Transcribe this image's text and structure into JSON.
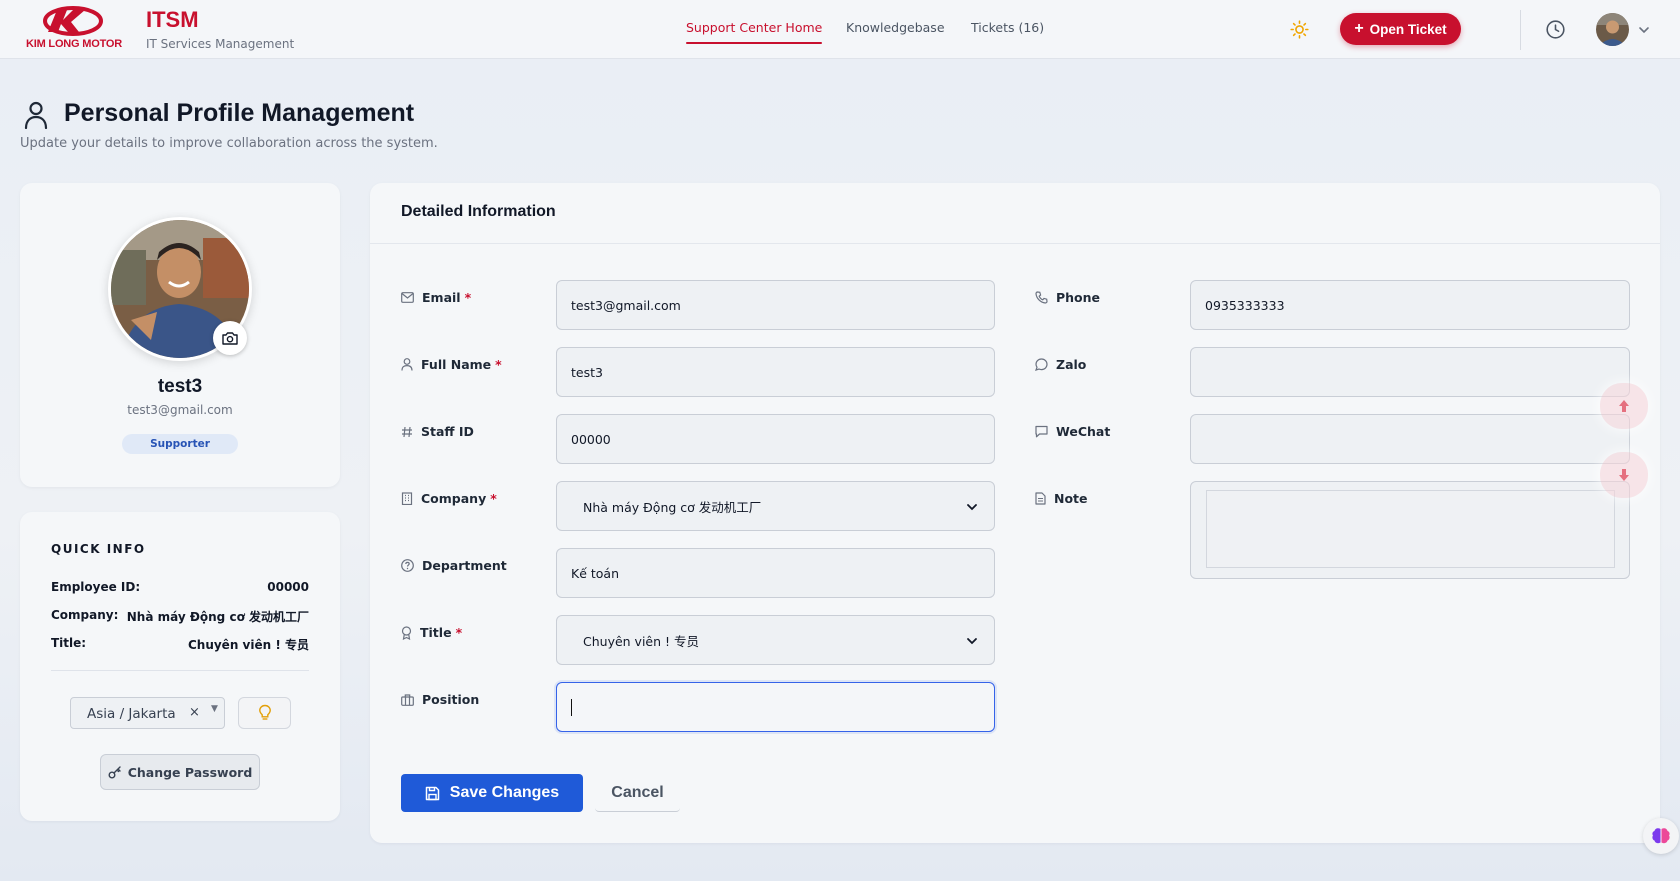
{
  "header": {
    "brand_name": "KIM LONG MOTOR",
    "app_title": "ITSM",
    "app_subtitle": "IT Services Management",
    "nav": [
      {
        "label": "Support Center Home",
        "active": true
      },
      {
        "label": "Knowledgebase",
        "active": false
      },
      {
        "label": "Tickets (16)",
        "active": false
      }
    ],
    "open_ticket_label": "Open Ticket",
    "icons": [
      "sun-icon",
      "clock-icon",
      "chevron-down-icon"
    ]
  },
  "page": {
    "title": "Personal Profile Management",
    "subtitle": "Update your details to improve collaboration across the system."
  },
  "profile": {
    "name": "test3",
    "email": "test3@gmail.com",
    "role": "Supporter"
  },
  "quick_info": {
    "title": "QUICK INFO",
    "rows": [
      {
        "label": "Employee ID:",
        "value": "00000"
      },
      {
        "label": "Company:",
        "value": "Nhà máy Động cơ 发动机工厂"
      },
      {
        "label": "Title:",
        "value": "Chuyên viên ! 专员"
      }
    ],
    "timezone": "Asia / Jakarta",
    "timezone_clear": "×",
    "change_password_label": "Change Password"
  },
  "details": {
    "title": "Detailed Information",
    "left_fields": [
      {
        "label": "Email",
        "required": true,
        "value": "test3@gmail.com",
        "icon": "mail-icon"
      },
      {
        "label": "Full Name",
        "required": true,
        "value": "test3",
        "icon": "person-icon"
      },
      {
        "label": "Staff ID",
        "required": false,
        "value": "00000",
        "icon": "hash-icon"
      },
      {
        "label": "Company",
        "required": true,
        "value": "Nhà máy Động cơ 发动机工厂",
        "icon": "building-icon"
      },
      {
        "label": "Department",
        "required": false,
        "value": "Kế toán",
        "icon": "help-circle-icon"
      },
      {
        "label": "Title",
        "required": true,
        "value": "Chuyên viên ! 专员",
        "icon": "award-icon"
      },
      {
        "label": "Position",
        "required": false,
        "value": "",
        "icon": "briefcase-icon"
      }
    ],
    "right_fields": [
      {
        "label": "Phone",
        "value": "0935333333",
        "icon": "phone-icon"
      },
      {
        "label": "Zalo",
        "value": "",
        "icon": "chat-circle-icon"
      },
      {
        "label": "WeChat",
        "value": "",
        "icon": "chat-square-icon"
      },
      {
        "label": "Note",
        "value": "",
        "icon": "file-icon"
      }
    ],
    "save_label": "Save Changes",
    "cancel_label": "Cancel"
  },
  "colors": {
    "brand_red": "#c8102e",
    "primary_blue": "#1f5ad8",
    "badge_bg": "#e0e9f7"
  }
}
